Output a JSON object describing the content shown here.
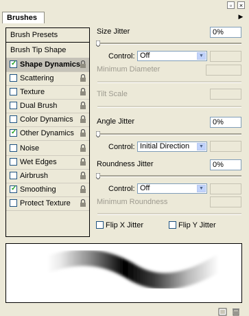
{
  "window": {
    "close_glyph": "×",
    "minimize_glyph": "▫"
  },
  "panel": {
    "tab_label": "Brushes",
    "menu_glyph": "▶"
  },
  "left_panel": {
    "presets_label": "Brush Presets",
    "tip_shape_label": "Brush Tip Shape",
    "items": [
      {
        "label": "Shape Dynamics",
        "checked": true,
        "selected": true
      },
      {
        "label": "Scattering",
        "checked": false
      },
      {
        "label": "Texture",
        "checked": false
      },
      {
        "label": "Dual Brush",
        "checked": false
      },
      {
        "label": "Color Dynamics",
        "checked": false
      },
      {
        "label": "Other Dynamics",
        "checked": true
      },
      {
        "label": "Noise",
        "checked": false
      },
      {
        "label": "Wet Edges",
        "checked": false
      },
      {
        "label": "Airbrush",
        "checked": false
      },
      {
        "label": "Smoothing",
        "checked": true
      },
      {
        "label": "Protect Texture",
        "checked": false
      }
    ],
    "check_glyph": "✓"
  },
  "controls": {
    "size_jitter": {
      "label": "Size Jitter",
      "value": "0%"
    },
    "size_control": {
      "label": "Control:",
      "value": "Off"
    },
    "min_diameter": {
      "label": "Minimum Diameter"
    },
    "tilt_scale": {
      "label": "Tilt Scale"
    },
    "angle_jitter": {
      "label": "Angle Jitter",
      "value": "0%"
    },
    "angle_control": {
      "label": "Control:",
      "value": "Initial Direction"
    },
    "roundness_jitter": {
      "label": "Roundness Jitter",
      "value": "0%"
    },
    "roundness_control": {
      "label": "Control:",
      "value": "Off"
    },
    "min_roundness": {
      "label": "Minimum Roundness"
    },
    "flip_x": {
      "label": "Flip X Jitter",
      "checked": false
    },
    "flip_y": {
      "label": "Flip Y Jitter",
      "checked": false
    }
  },
  "icons": {
    "lock": "lock-icon",
    "new_preset": "new-preset-icon",
    "trash": "trash-icon"
  }
}
